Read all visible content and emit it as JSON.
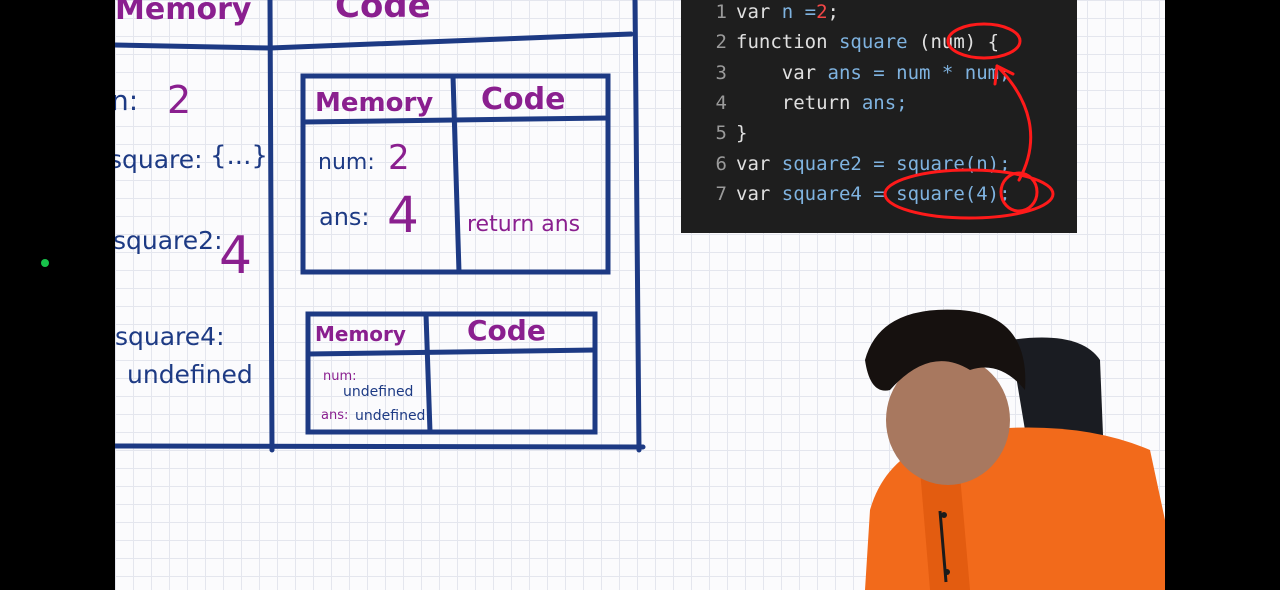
{
  "whiteboard": {
    "global_memory_header": "Memory",
    "global_code_header": "Code",
    "global_memory": [
      {
        "name": "n:",
        "value": "2"
      },
      {
        "name": "square:",
        "value": "{...}"
      },
      {
        "name": "square2:",
        "value": "4"
      },
      {
        "name": "square4:",
        "value": "undefined"
      }
    ],
    "ctx1": {
      "memory_header": "Memory",
      "code_header": "Code",
      "num_label": "num:",
      "num_value": "2",
      "ans_label": "ans:",
      "ans_value": "4",
      "code_text": "return ans"
    },
    "ctx2": {
      "memory_header": "Memory",
      "code_header": "Code",
      "num_label": "num:",
      "num_value": "undefined",
      "ans_label": "ans:",
      "ans_value": "undefined"
    }
  },
  "code_editor": {
    "lines": [
      {
        "n": "1",
        "parts": [
          {
            "t": "var ",
            "c": "kw"
          },
          {
            "t": "n =",
            "c": "var"
          },
          {
            "t": "2",
            "c": "num"
          },
          {
            "t": ";",
            "c": "kw"
          }
        ]
      },
      {
        "n": "2",
        "parts": [
          {
            "t": "function ",
            "c": "kw"
          },
          {
            "t": "square ",
            "c": "var"
          },
          {
            "t": "(num) {",
            "c": "kw"
          }
        ]
      },
      {
        "n": "3",
        "parts": [
          {
            "t": "    var ",
            "c": "kw"
          },
          {
            "t": "ans = num * num;",
            "c": "var"
          }
        ]
      },
      {
        "n": "4",
        "parts": [
          {
            "t": "    return ",
            "c": "kw"
          },
          {
            "t": "ans;",
            "c": "var"
          }
        ]
      },
      {
        "n": "5",
        "parts": [
          {
            "t": "}",
            "c": "kw"
          }
        ]
      },
      {
        "n": "6",
        "parts": [
          {
            "t": "var ",
            "c": "kw"
          },
          {
            "t": "square2 = square(n);",
            "c": "var"
          }
        ]
      },
      {
        "n": "7",
        "parts": [
          {
            "t": "var ",
            "c": "kw"
          },
          {
            "t": "square4 = square(4);",
            "c": "var"
          }
        ]
      }
    ]
  },
  "colors": {
    "ink_blue": "#1d3a84",
    "ink_purple": "#8a1f8f",
    "annotation_red": "#ff1a1a",
    "shirt_orange": "#f26a1b"
  }
}
